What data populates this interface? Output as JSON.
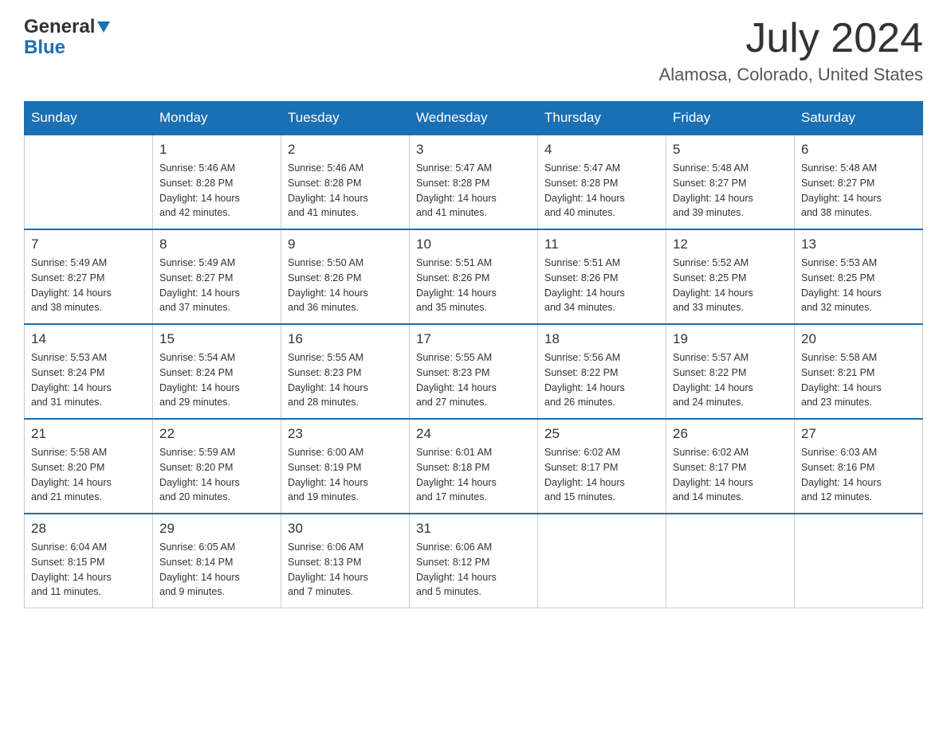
{
  "header": {
    "logo_general": "General",
    "logo_blue": "Blue",
    "month_title": "July 2024",
    "location": "Alamosa, Colorado, United States"
  },
  "weekdays": [
    "Sunday",
    "Monday",
    "Tuesday",
    "Wednesday",
    "Thursday",
    "Friday",
    "Saturday"
  ],
  "weeks": [
    [
      {
        "day": "",
        "info": ""
      },
      {
        "day": "1",
        "info": "Sunrise: 5:46 AM\nSunset: 8:28 PM\nDaylight: 14 hours\nand 42 minutes."
      },
      {
        "day": "2",
        "info": "Sunrise: 5:46 AM\nSunset: 8:28 PM\nDaylight: 14 hours\nand 41 minutes."
      },
      {
        "day": "3",
        "info": "Sunrise: 5:47 AM\nSunset: 8:28 PM\nDaylight: 14 hours\nand 41 minutes."
      },
      {
        "day": "4",
        "info": "Sunrise: 5:47 AM\nSunset: 8:28 PM\nDaylight: 14 hours\nand 40 minutes."
      },
      {
        "day": "5",
        "info": "Sunrise: 5:48 AM\nSunset: 8:27 PM\nDaylight: 14 hours\nand 39 minutes."
      },
      {
        "day": "6",
        "info": "Sunrise: 5:48 AM\nSunset: 8:27 PM\nDaylight: 14 hours\nand 38 minutes."
      }
    ],
    [
      {
        "day": "7",
        "info": "Sunrise: 5:49 AM\nSunset: 8:27 PM\nDaylight: 14 hours\nand 38 minutes."
      },
      {
        "day": "8",
        "info": "Sunrise: 5:49 AM\nSunset: 8:27 PM\nDaylight: 14 hours\nand 37 minutes."
      },
      {
        "day": "9",
        "info": "Sunrise: 5:50 AM\nSunset: 8:26 PM\nDaylight: 14 hours\nand 36 minutes."
      },
      {
        "day": "10",
        "info": "Sunrise: 5:51 AM\nSunset: 8:26 PM\nDaylight: 14 hours\nand 35 minutes."
      },
      {
        "day": "11",
        "info": "Sunrise: 5:51 AM\nSunset: 8:26 PM\nDaylight: 14 hours\nand 34 minutes."
      },
      {
        "day": "12",
        "info": "Sunrise: 5:52 AM\nSunset: 8:25 PM\nDaylight: 14 hours\nand 33 minutes."
      },
      {
        "day": "13",
        "info": "Sunrise: 5:53 AM\nSunset: 8:25 PM\nDaylight: 14 hours\nand 32 minutes."
      }
    ],
    [
      {
        "day": "14",
        "info": "Sunrise: 5:53 AM\nSunset: 8:24 PM\nDaylight: 14 hours\nand 31 minutes."
      },
      {
        "day": "15",
        "info": "Sunrise: 5:54 AM\nSunset: 8:24 PM\nDaylight: 14 hours\nand 29 minutes."
      },
      {
        "day": "16",
        "info": "Sunrise: 5:55 AM\nSunset: 8:23 PM\nDaylight: 14 hours\nand 28 minutes."
      },
      {
        "day": "17",
        "info": "Sunrise: 5:55 AM\nSunset: 8:23 PM\nDaylight: 14 hours\nand 27 minutes."
      },
      {
        "day": "18",
        "info": "Sunrise: 5:56 AM\nSunset: 8:22 PM\nDaylight: 14 hours\nand 26 minutes."
      },
      {
        "day": "19",
        "info": "Sunrise: 5:57 AM\nSunset: 8:22 PM\nDaylight: 14 hours\nand 24 minutes."
      },
      {
        "day": "20",
        "info": "Sunrise: 5:58 AM\nSunset: 8:21 PM\nDaylight: 14 hours\nand 23 minutes."
      }
    ],
    [
      {
        "day": "21",
        "info": "Sunrise: 5:58 AM\nSunset: 8:20 PM\nDaylight: 14 hours\nand 21 minutes."
      },
      {
        "day": "22",
        "info": "Sunrise: 5:59 AM\nSunset: 8:20 PM\nDaylight: 14 hours\nand 20 minutes."
      },
      {
        "day": "23",
        "info": "Sunrise: 6:00 AM\nSunset: 8:19 PM\nDaylight: 14 hours\nand 19 minutes."
      },
      {
        "day": "24",
        "info": "Sunrise: 6:01 AM\nSunset: 8:18 PM\nDaylight: 14 hours\nand 17 minutes."
      },
      {
        "day": "25",
        "info": "Sunrise: 6:02 AM\nSunset: 8:17 PM\nDaylight: 14 hours\nand 15 minutes."
      },
      {
        "day": "26",
        "info": "Sunrise: 6:02 AM\nSunset: 8:17 PM\nDaylight: 14 hours\nand 14 minutes."
      },
      {
        "day": "27",
        "info": "Sunrise: 6:03 AM\nSunset: 8:16 PM\nDaylight: 14 hours\nand 12 minutes."
      }
    ],
    [
      {
        "day": "28",
        "info": "Sunrise: 6:04 AM\nSunset: 8:15 PM\nDaylight: 14 hours\nand 11 minutes."
      },
      {
        "day": "29",
        "info": "Sunrise: 6:05 AM\nSunset: 8:14 PM\nDaylight: 14 hours\nand 9 minutes."
      },
      {
        "day": "30",
        "info": "Sunrise: 6:06 AM\nSunset: 8:13 PM\nDaylight: 14 hours\nand 7 minutes."
      },
      {
        "day": "31",
        "info": "Sunrise: 6:06 AM\nSunset: 8:12 PM\nDaylight: 14 hours\nand 5 minutes."
      },
      {
        "day": "",
        "info": ""
      },
      {
        "day": "",
        "info": ""
      },
      {
        "day": "",
        "info": ""
      }
    ]
  ]
}
